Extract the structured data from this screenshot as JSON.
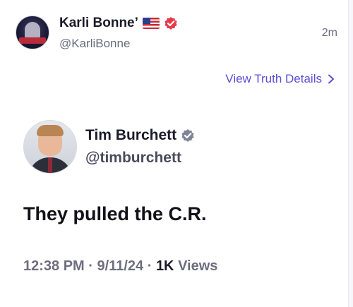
{
  "post": {
    "author": {
      "display_name": "Karli Bonne’",
      "handle": "@KarliBonne",
      "flag_icon": "us-flag-icon",
      "badge_icon": "verified-badge-icon",
      "badge_color": "#e8394b"
    },
    "timestamp": "2m",
    "details_link": {
      "label": "View Truth Details",
      "icon": "chevron-right-icon",
      "color": "#5a4fd4"
    },
    "embedded": {
      "author": {
        "display_name": "Tim Burchett",
        "handle": "@timburchett",
        "badge_icon": "verified-badge-icon",
        "badge_color": "#7d8597"
      },
      "text": "They pulled the C.R.",
      "time": "12:38 PM",
      "separator": "·",
      "date": "9/11/24",
      "views_count": "1K",
      "views_label": "Views"
    }
  }
}
